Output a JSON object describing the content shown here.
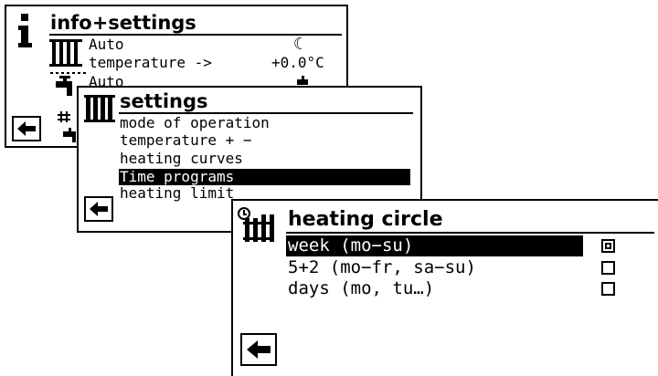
{
  "panel1": {
    "title": "info+settings",
    "rows": [
      {
        "label": "Auto",
        "value": "☾"
      },
      {
        "label": "temperature ->",
        "value": "+0.0°C"
      },
      {
        "label": "Auto",
        "value": ""
      }
    ]
  },
  "panel2": {
    "title": "settings",
    "items": [
      "mode of operation",
      "temperature + −",
      "heating curves",
      "Time programs",
      "heating limit"
    ]
  },
  "panel3": {
    "title": "heating circle",
    "options": [
      {
        "label": "week (mo−su)",
        "checked": true
      },
      {
        "label": "5+2 (mo−fr, sa−su)",
        "checked": false
      },
      {
        "label": "days (mo, tu…)",
        "checked": false
      }
    ]
  }
}
